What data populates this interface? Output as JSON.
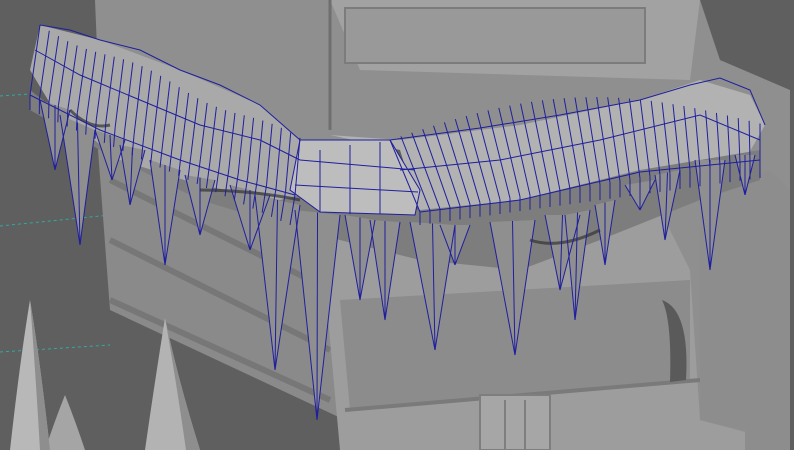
{
  "viewport": {
    "background": "#5f5f5f",
    "wire_color": "#1f1f9e",
    "mesh_fill": "#a7a7a7",
    "mesh_shadow": "#6f6f6f",
    "building_light": "#a9a9a9",
    "building_mid": "#8e8e8e",
    "building_dark": "#7a7a7a",
    "grid_line_color": "#2bb3a7"
  },
  "objects": [
    {
      "name": "building",
      "selected": false
    },
    {
      "name": "icicle-eave",
      "selected": true,
      "display": "wireframe-on-shaded"
    },
    {
      "name": "spike",
      "selected": false
    }
  ]
}
